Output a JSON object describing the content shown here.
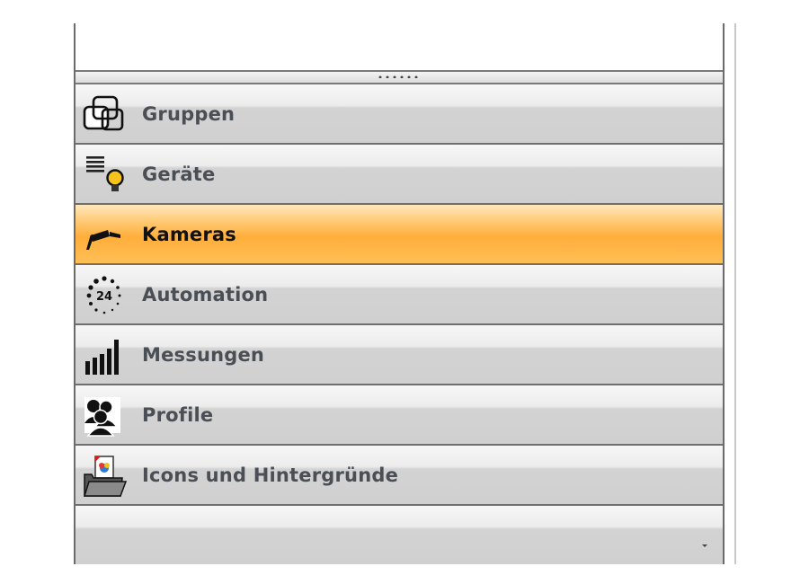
{
  "nav": {
    "items": [
      {
        "label": "Gruppen",
        "icon": "groups-icon"
      },
      {
        "label": "Geräte",
        "icon": "devices-icon"
      },
      {
        "label": "Kameras",
        "icon": "camera-icon",
        "selected": true
      },
      {
        "label": "Automation",
        "icon": "automation-24-icon",
        "icon_text": "24"
      },
      {
        "label": "Messungen",
        "icon": "measurements-bars-icon"
      },
      {
        "label": "Profile",
        "icon": "profiles-icon"
      },
      {
        "label": "Icons und Hintergründe",
        "icon": "icons-backgrounds-icon"
      }
    ],
    "selected_index": 2
  },
  "colors": {
    "selected_top": "#ffe7bd",
    "selected_bottom": "#ffae3b",
    "item_light": "#f7f7f7",
    "item_dark": "#d0d0d0",
    "border": "#6f6f6f",
    "label": "#4a4f55"
  }
}
